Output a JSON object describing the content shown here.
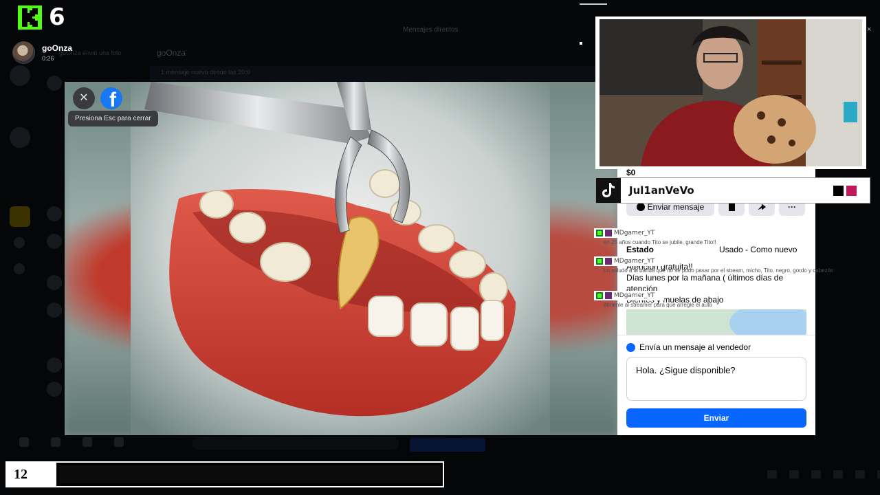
{
  "kick": {
    "channel_number": "6"
  },
  "top_user": {
    "name": "goOnza",
    "time": "0:26"
  },
  "background": {
    "header_title": "Mensajes directos",
    "chat_name": "goOnza",
    "message_preview": "goOnza envió una foto",
    "notice": "1 mensaje nuevo desde las 20:0"
  },
  "viewer": {
    "close_tooltip": "Presiona Esc para cerrar",
    "close_symbol": "✕",
    "fb_symbol": "f"
  },
  "marketplace": {
    "price": "$0",
    "send_message_label": "Enviar mensaje",
    "more_label": "···",
    "estado_label": "Estado",
    "estado_value": "Usado - Como nuevo",
    "description": [
      "Atención gratuita!!",
      "Días lunes por la mañana ( últimos días de atención",
      "Dientes y muelas de abajo"
    ],
    "message_box_title": "Envía un mensaje al vendedor",
    "message_text": "Hola. ¿Sigue disponible?",
    "send_button": "Enviar",
    "accent_color": "#0866ff"
  },
  "tiktok": {
    "username": "Jul1anVeVo",
    "color_swatches": [
      "#000000",
      "#c2185b"
    ]
  },
  "chat": [
    {
      "user": "MDgamer_YT",
      "text": "en 25 años cuando Tito se jubile, grande Tito!!"
    },
    {
      "user": "MDgamer_YT",
      "text": "un saludo a la banda que no se pudo pasar por el stream, micho, Tito, negro, gordo y cabezón"
    },
    {
      "user": "MDgamer_YT",
      "text": "donenle al streamer para que arregle el auto"
    }
  ],
  "bottom": {
    "number": "12"
  },
  "webcam": {
    "close_symbol": "×"
  },
  "colors": {
    "kick_green": "#53fc18",
    "facebook_blue": "#1877f2"
  }
}
